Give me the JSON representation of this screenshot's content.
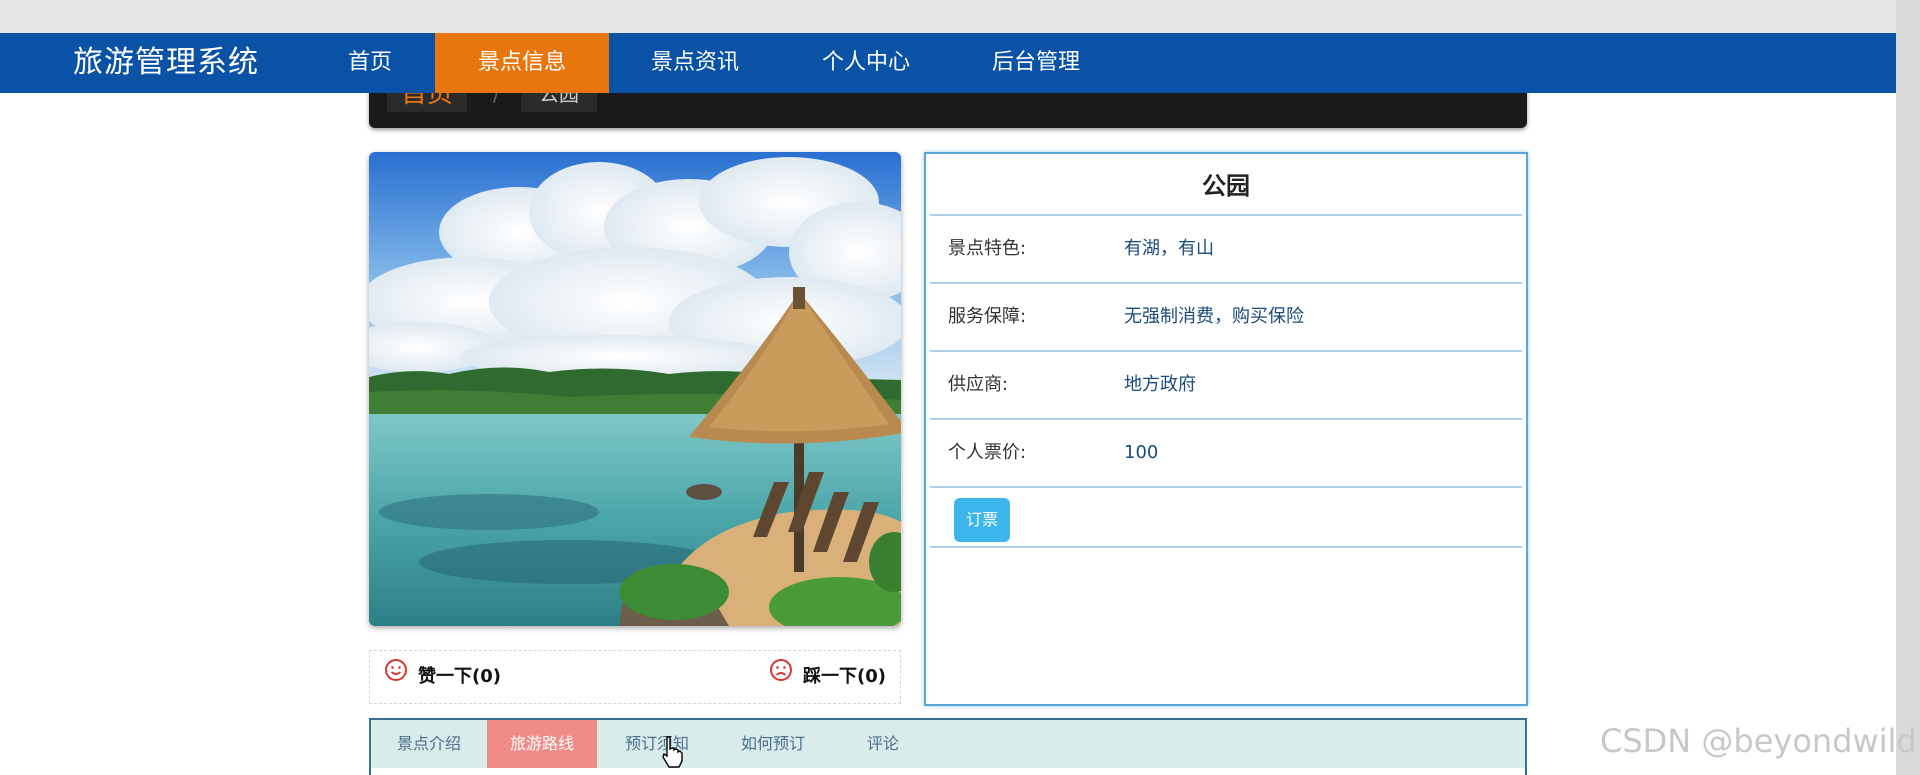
{
  "nav": {
    "brand": "旅游管理系统",
    "items": [
      {
        "label": "首页",
        "active": false
      },
      {
        "label": "景点信息",
        "active": true
      },
      {
        "label": "景点资讯",
        "active": false
      },
      {
        "label": "个人中心",
        "active": false
      },
      {
        "label": "后台管理",
        "active": false
      }
    ]
  },
  "breadcrumb": {
    "home": "首页",
    "separator": "/",
    "current": "公园"
  },
  "attraction": {
    "name": "公园",
    "image": "tropical-lake-beach-umbrella",
    "fields": [
      {
        "label": "景点特色:",
        "value": "有湖，有山"
      },
      {
        "label": "服务保障:",
        "value": "无强制消费，购买保险"
      },
      {
        "label": "供应商:",
        "value": "地方政府"
      },
      {
        "label": "个人票价:",
        "value": "100"
      }
    ],
    "book_label": "订票"
  },
  "votes": {
    "like_label": "赞一下(0)",
    "dislike_label": "踩一下(0)"
  },
  "tabs": [
    {
      "label": "景点介绍",
      "active": false
    },
    {
      "label": "旅游路线",
      "active": true
    },
    {
      "label": "预订须知",
      "active": false
    },
    {
      "label": "如何预订",
      "active": false
    },
    {
      "label": "评论",
      "active": false
    }
  ],
  "watermark": "CSDN @beyondwild",
  "colors": {
    "nav_bg": "#0a52a6",
    "nav_active": "#e8760c",
    "tab_active": "#ef8c88",
    "book_button": "#3cb6ea",
    "panel_border": "#5aa7d6"
  }
}
